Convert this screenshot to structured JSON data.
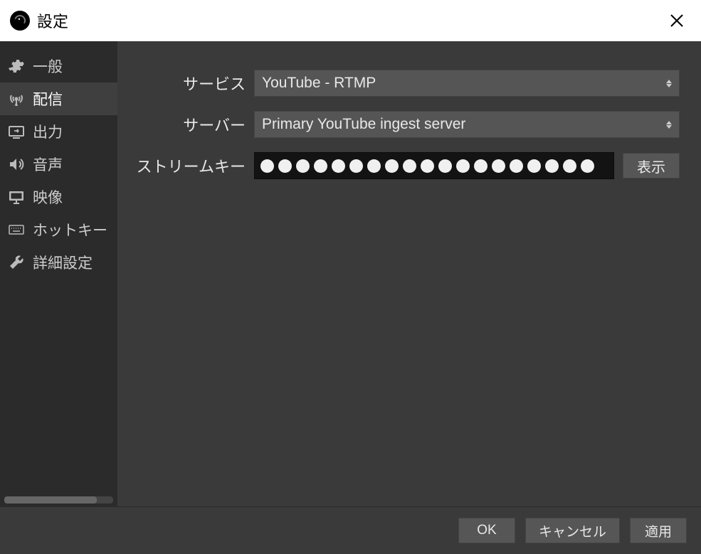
{
  "window": {
    "title": "設定"
  },
  "sidebar": {
    "items": [
      {
        "icon": "gear",
        "label": "一般"
      },
      {
        "icon": "antenna",
        "label": "配信"
      },
      {
        "icon": "output",
        "label": "出力"
      },
      {
        "icon": "speaker",
        "label": "音声"
      },
      {
        "icon": "monitor",
        "label": "映像"
      },
      {
        "icon": "keyboard",
        "label": "ホットキー"
      },
      {
        "icon": "wrench",
        "label": "詳細設定"
      }
    ],
    "selected_index": 1
  },
  "form": {
    "service": {
      "label": "サービス",
      "value": "YouTube - RTMP"
    },
    "server": {
      "label": "サーバー",
      "value": "Primary YouTube ingest server"
    },
    "stream_key": {
      "label": "ストリームキー",
      "masked_length": 19,
      "show_button": "表示"
    }
  },
  "footer": {
    "ok": "OK",
    "cancel": "キャンセル",
    "apply": "適用"
  }
}
